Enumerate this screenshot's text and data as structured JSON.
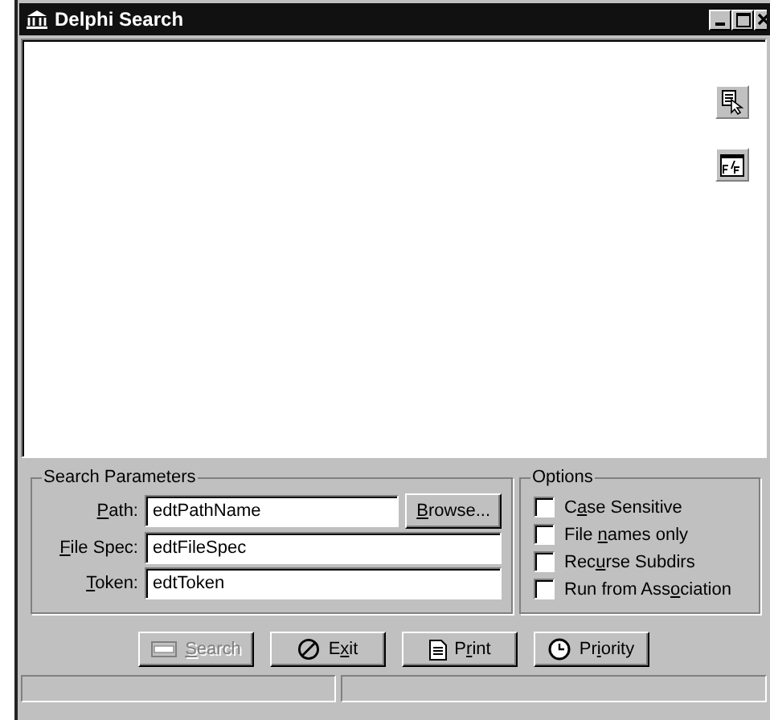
{
  "window": {
    "title": "Delphi Search"
  },
  "tool_buttons": [
    {
      "kind": "select"
    },
    {
      "kind": "font"
    }
  ],
  "search_parameters": {
    "title": "Search Parameters",
    "fields": [
      {
        "label": {
          "key": "P",
          "after": "ath:"
        },
        "value": "edtPathName",
        "button": {
          "key": "B",
          "after": "rowse..."
        }
      },
      {
        "label": {
          "key": "F",
          "after": "ile Spec:"
        },
        "value": "edtFileSpec"
      },
      {
        "label": {
          "key": "T",
          "after": "oken:"
        },
        "value": "edtToken"
      }
    ]
  },
  "options": {
    "title": "Options",
    "items": [
      {
        "label": {
          "before": "C",
          "key": "a",
          "after": "se Sensitive"
        },
        "checked": false
      },
      {
        "label": {
          "before": "File ",
          "key": "n",
          "after": "ames only"
        },
        "checked": false
      },
      {
        "label": {
          "before": "Rec",
          "key": "u",
          "after": "rse Subdirs"
        },
        "checked": false
      },
      {
        "label": {
          "before": "Run from Ass",
          "key": "o",
          "after": "ciation"
        },
        "checked": false
      }
    ]
  },
  "buttons": [
    {
      "kind": "search",
      "label": {
        "key": "S",
        "after": "earch"
      },
      "disabled": true
    },
    {
      "kind": "exit",
      "label": {
        "before": "E",
        "key": "x",
        "after": "it"
      },
      "disabled": false
    },
    {
      "kind": "print",
      "label": {
        "before": "P",
        "key": "r",
        "after": "int"
      },
      "disabled": false
    },
    {
      "kind": "priority",
      "label": {
        "before": "Pr",
        "key": "i",
        "after": "ority"
      },
      "disabled": false
    }
  ]
}
